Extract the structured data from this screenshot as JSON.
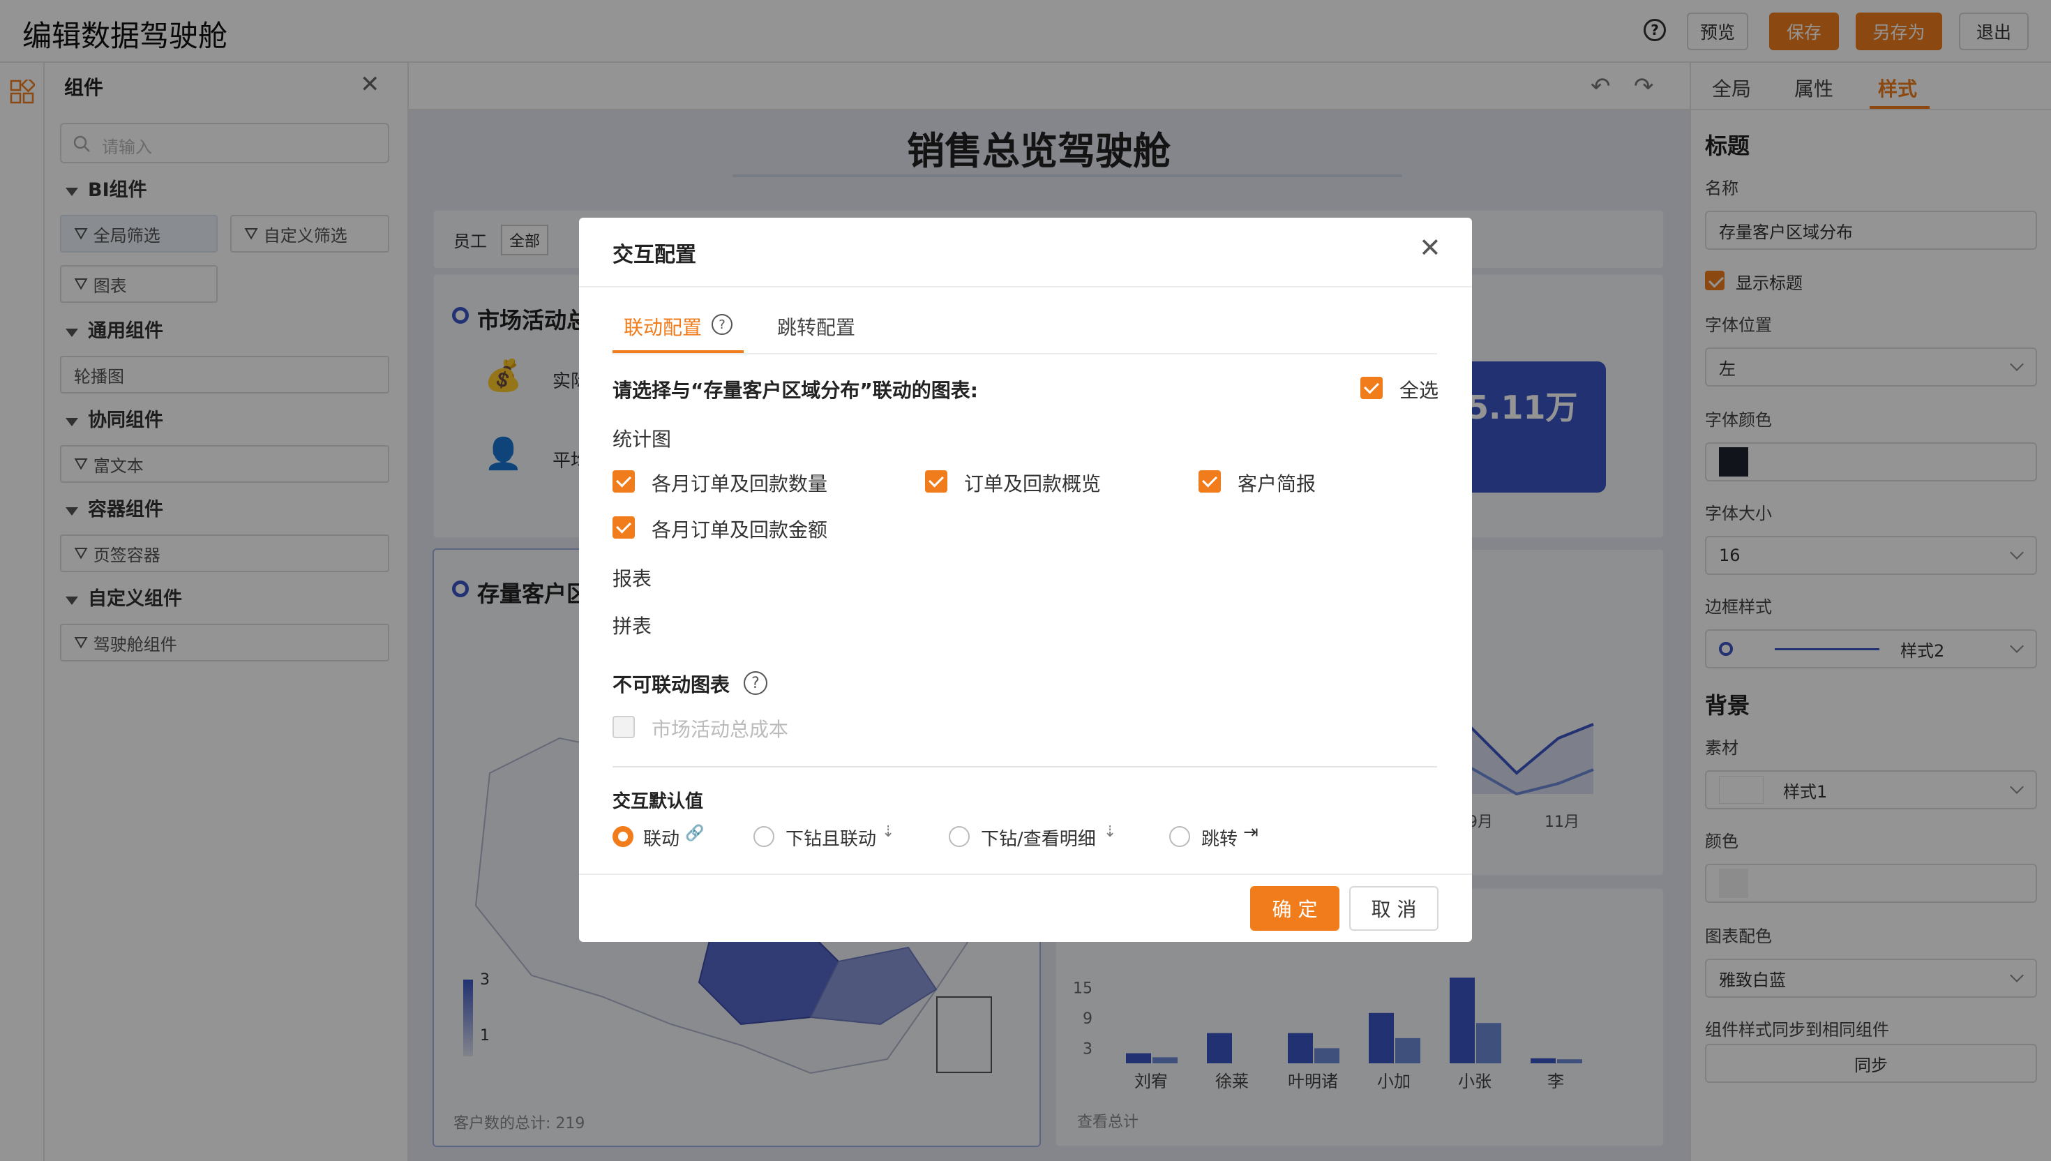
{
  "app": {
    "title": "编辑数据驾驶舱",
    "help": "?",
    "buttons": {
      "preview": "预览",
      "save": "保存",
      "save_as": "另存为",
      "exit": "退出"
    }
  },
  "components_panel": {
    "title": "组件",
    "search_placeholder": "请输入",
    "groups": [
      {
        "title": "BI组件",
        "items": [
          "全局筛选",
          "自定义筛选",
          "图表"
        ]
      },
      {
        "title": "通用组件",
        "items": [
          "轮播图"
        ]
      },
      {
        "title": "协同组件",
        "items": [
          "富文本"
        ]
      },
      {
        "title": "容器组件",
        "items": [
          "页签容器"
        ]
      },
      {
        "title": "自定义组件",
        "items": [
          "驾驶舱组件"
        ]
      }
    ]
  },
  "canvas": {
    "dashboard_title": "销售总览驾驶舱",
    "filter_label": "员工",
    "filter_value": "全部",
    "card_market_title": "市场活动总",
    "card_market_row1": "实际",
    "card_market_row2": "平均",
    "kpi_value": "5.11万",
    "card_region_title": "存量客户区",
    "legend_max": "3",
    "legend_min": "1",
    "region_footer": "客户数的总计: 219",
    "line_xticks": [
      "9月",
      "11月"
    ],
    "bar_footer": "查看总计",
    "bar_chart": {
      "type": "bar",
      "categories": [
        "刘宥",
        "徐莱",
        "叶明诸",
        "小加",
        "小张",
        "李"
      ],
      "yticks": [
        "15",
        "9",
        "3"
      ],
      "series": [
        {
          "values": [
            2,
            6,
            6,
            10,
            17,
            1
          ],
          "color": "#3b55c4"
        },
        {
          "values": [
            1.2,
            0,
            3,
            5,
            8,
            0.8
          ],
          "color": "#6f8bd8"
        }
      ],
      "ylim": [
        0,
        18
      ]
    }
  },
  "style_panel": {
    "tabs": [
      "全局",
      "属性",
      "样式"
    ],
    "active_tab": "样式",
    "section_title": "标题",
    "name_label": "名称",
    "name_value": "存量客户区域分布",
    "show_title": "显示标题",
    "font_position_label": "字体位置",
    "font_position_value": "左",
    "font_color_label": "字体颜色",
    "font_color": "#1f2430",
    "font_size_label": "字体大小",
    "font_size_value": "16",
    "border_label": "边框样式",
    "border_value": "样式2",
    "bg_title": "背景",
    "material_label": "素材",
    "material_value": "样式1",
    "color_label": "颜色",
    "palette_label": "图表配色",
    "palette_value": "雅致白蓝",
    "sync_label": "组件样式同步到相同组件",
    "sync_button": "同步"
  },
  "dialog": {
    "title": "交互配置",
    "tabs": [
      "联动配置",
      "跳转配置"
    ],
    "active_tab": "联动配置",
    "prompt": "请选择与“存量客户区域分布”联动的图表:",
    "select_all": "全选",
    "stat_label": "统计图",
    "charts": [
      "各月订单及回款数量",
      "订单及回款概览",
      "客户简报",
      "各月订单及回款金额"
    ],
    "report_label": "报表",
    "joint_label": "拼表",
    "unlinkable_label": "不可联动图表",
    "unlinkable_items": [
      "市场活动总成本"
    ],
    "default_label": "交互默认值",
    "defaults": [
      "联动",
      "下钻且联动",
      "下钻/查看明细",
      "跳转"
    ],
    "default_selected": "联动",
    "confirm": "确 定",
    "cancel": "取 消"
  },
  "colors": {
    "accent": "#f07c1c",
    "blue": "#3b55c4",
    "overlay": "rgba(0,0,0,0.42)"
  }
}
